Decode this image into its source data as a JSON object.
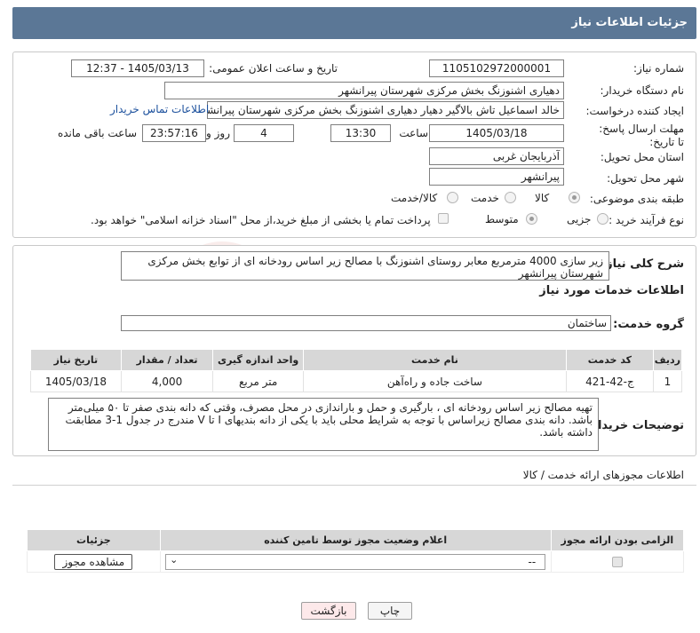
{
  "header": {
    "title": "جزئیات اطلاعات نیاز"
  },
  "form": {
    "need_number_label": "شماره نیاز:",
    "need_number": "1105102972000001",
    "announce_label": "تاریخ و ساعت اعلان عمومی:",
    "announce_value": "1405/03/13 - 12:37",
    "buyer_label": "نام دستگاه خریدار:",
    "buyer_value": "دهیاری اشنوزنگ بخش مرکزی شهرستان پیرانشهر",
    "requester_label": "ایجاد کننده درخواست:",
    "requester_value": "خالد اسماعیل تاش بالاگیر دهیار دهیاری اشنوزنگ بخش مرکزی شهرستان پیرانشهر",
    "contact_link": "اطلاعات تماس خریدار",
    "deadline_label": "مهلت ارسال پاسخ: تا تاریخ:",
    "deadline_date": "1405/03/18",
    "time_label": "ساعت",
    "deadline_time": "13:30",
    "days_value": "4",
    "days_label": "روز و",
    "remaining_time": "23:57:16",
    "remaining_label": "ساعت باقی مانده",
    "province_label": "استان محل تحویل:",
    "province_value": "آذربایجان غربی",
    "city_label": "شهر محل تحویل:",
    "city_value": "پیرانشهر",
    "category_label": "طبقه بندی موضوعی:",
    "category_options": [
      "کالا",
      "خدمت",
      "کالا/خدمت"
    ],
    "process_label": "نوع فرآیند خرید :",
    "process_options": [
      "جزیی",
      "متوسط"
    ],
    "payment_note": "پرداخت تمام یا بخشی از مبلغ خرید،از محل \"اسناد خزانه اسلامی\" خواهد بود."
  },
  "summary": {
    "label": "شرح کلی نیاز:",
    "text": "زیر سازی 4000 مترمربع معابر روستای اشنوزنگ با مصالح زیر اساس رودخانه ای از توابع بخش مرکزی شهرستان پیرانشهر"
  },
  "services": {
    "title": "اطلاعات خدمات مورد نیاز",
    "group_label": "گروه خدمت:",
    "group_value": "ساختمان",
    "columns": [
      "ردیف",
      "کد خدمت",
      "نام خدمت",
      "واحد اندازه گیری",
      "تعداد / مقدار",
      "تاریخ نیاز"
    ],
    "rows": [
      {
        "row": "1",
        "code": "ج-42-421",
        "name": "ساخت جاده و راه‌آهن",
        "unit": "متر مربع",
        "qty": "4,000",
        "date": "1405/03/18"
      }
    ]
  },
  "buyer_notes": {
    "label": "توضیحات خریدار:",
    "text": "تهیه مصالح زیر اساس  رودخانه ای ، بارگیری و حمل و باراندازی در محل مصرف، وقتی که دانه بندی صفر تا ۵۰ میلی‌متر باشد. دانه بندی مصالح زیراساس با توجه به شرایط محلی باید با یکی از دانه بندیهای I تا V مندرج در جدول 1-3 مطابقت داشته باشد."
  },
  "permits": {
    "title": "اطلاعات مجوزهای ارائه خدمت / کالا",
    "columns": [
      "الزامی بودن ارائه مجوز",
      "اعلام وضعیت مجوز توسط تامین کننده",
      "جزئیات"
    ],
    "select_value": "--",
    "view_button": "مشاهده مجوز"
  },
  "footer": {
    "print_button": "چاپ",
    "back_button": "بازگشت"
  },
  "colors": {
    "header_bg": "#5b7796",
    "table_header_bg": "#d7d7d7",
    "back_button_bg": "#fde9ea",
    "link": "#1a4f9c"
  }
}
